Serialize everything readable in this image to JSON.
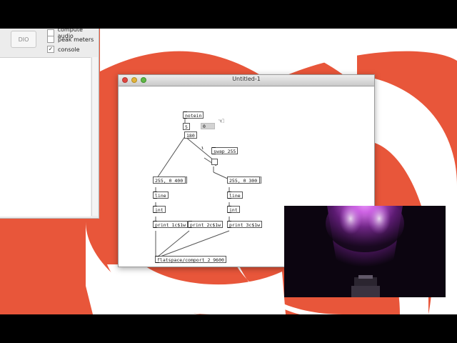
{
  "pd_main": {
    "dio_button": "DIO",
    "options": [
      {
        "label": "compute audio",
        "checked": false
      },
      {
        "label": "peak meters",
        "checked": false
      },
      {
        "label": "console",
        "checked": true
      }
    ]
  },
  "patch_window": {
    "title": "Untitled-1",
    "objects": {
      "notein": "notein",
      "num1": "5",
      "num2": "0",
      "num3": "180",
      "swap": "swap 255",
      "msg1": "255, 0 400",
      "msg2": "255, 0 300",
      "line1": "line",
      "line2": "line",
      "int1": "int",
      "int2": "int",
      "print1": "print 1c$1w",
      "print2": "print 2c$1w",
      "print3": "print 3c$1w",
      "comport": "flatspace/comport 2 9600"
    }
  },
  "colors": {
    "background_orange": "#e8563a",
    "lamp_glow": "#c95ae0"
  }
}
